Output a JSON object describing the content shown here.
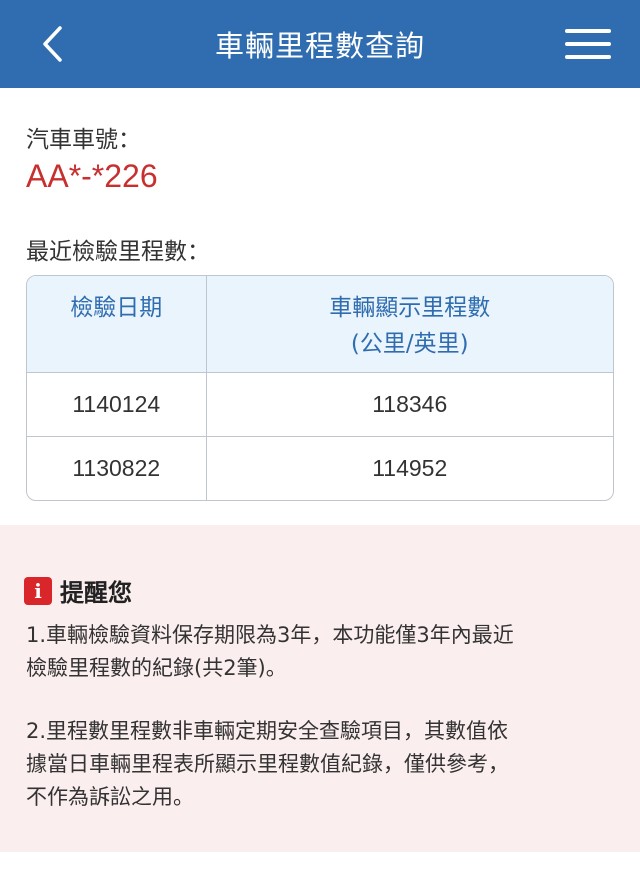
{
  "header": {
    "title": "車輛里程數查詢",
    "back_icon": "chevron-left-icon",
    "menu_icon": "hamburger-menu-icon",
    "color": "#2f6db0"
  },
  "vehicle": {
    "plate_label": "汽車車號：",
    "plate": "AA*-*226",
    "plate_color": "#c8302f"
  },
  "mileage": {
    "section_label": "最近檢驗里程數：",
    "columns": [
      "檢驗日期",
      "車輛顯示里程數",
      "(公里/英里)"
    ],
    "rows": [
      {
        "date": "1140124",
        "mileage": "118346"
      },
      {
        "date": "1130822",
        "mileage": "114952"
      }
    ]
  },
  "notice": {
    "icon": "info-alert-icon",
    "icon_letter": "i",
    "title": "提醒您",
    "item1_line1": "1.車輛檢驗資料保存期限為3年，本功能僅3年內最近",
    "item1_line2": "檢驗里程數的紀錄(共2筆)。",
    "item2_line1": "2.里程數里程數非車輛定期安全查驗項目，其數值依",
    "item2_line2": "據當日車輛里程表所顯示里程數值紀錄，僅供參考，",
    "item2_line3": "不作為訴訟之用。"
  }
}
